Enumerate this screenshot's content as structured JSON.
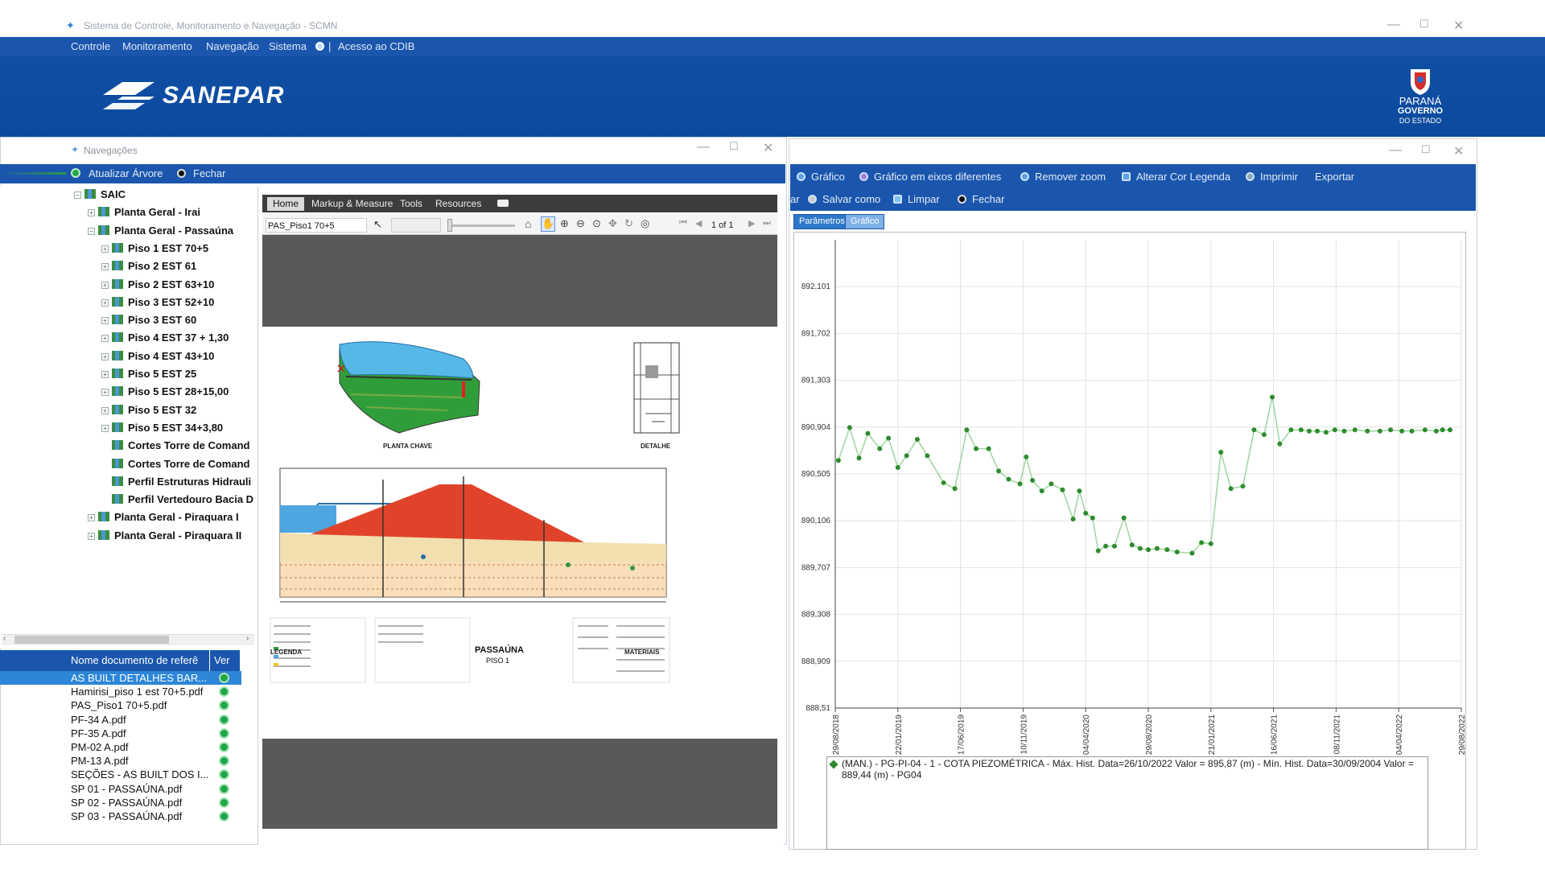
{
  "app": {
    "title": "Sistema de Controle, Monitoramento e Navegação - SCMN",
    "menu": [
      "Controle",
      "Monitoramento",
      "Navegação",
      "Sistema",
      "Acesso ao CDIB"
    ],
    "brand": "SANEPAR",
    "state_logo": [
      "PARANÁ",
      "GOVERNO",
      "DO ESTADO"
    ],
    "colors": {
      "primary": "#1a56ad",
      "banner": "#0f4fa4",
      "series": "#2e8b2e",
      "selected_row": "#2d86d7"
    }
  },
  "nav_window": {
    "title": "Navegações",
    "toolbar": {
      "refresh_label": "Atualizar Árvore",
      "close_label": "Fechar"
    },
    "tree": {
      "root": "SAIC",
      "items": [
        {
          "label": "Planta Geral - Irai",
          "level": 1,
          "expander": "+"
        },
        {
          "label": "Planta Geral - Passaúna",
          "level": 1,
          "expander": "−"
        },
        {
          "label": "Piso 1 EST 70+5",
          "level": 2,
          "expander": "+"
        },
        {
          "label": "Piso 2 EST 61",
          "level": 2,
          "expander": "+"
        },
        {
          "label": "Piso 2 EST 63+10",
          "level": 2,
          "expander": "+"
        },
        {
          "label": "Piso 3 EST 52+10",
          "level": 2,
          "expander": "+"
        },
        {
          "label": "Piso 3 EST 60",
          "level": 2,
          "expander": "+"
        },
        {
          "label": "Piso 4 EST 37 + 1,30",
          "level": 2,
          "expander": "+"
        },
        {
          "label": "Piso 4 EST 43+10",
          "level": 2,
          "expander": "+"
        },
        {
          "label": "Piso 5 EST 25",
          "level": 2,
          "expander": "+"
        },
        {
          "label": "Piso 5 EST 28+15,00",
          "level": 2,
          "expander": "+"
        },
        {
          "label": "Piso 5 EST 32",
          "level": 2,
          "expander": "+"
        },
        {
          "label": "Piso 5 EST 34+3,80",
          "level": 2,
          "expander": "+"
        },
        {
          "label": "Cortes Torre de Comand",
          "level": 2,
          "expander": ""
        },
        {
          "label": "Cortes Torre de Comand",
          "level": 2,
          "expander": ""
        },
        {
          "label": "Perfil Estruturas Hidrauli",
          "level": 2,
          "expander": ""
        },
        {
          "label": "Perfil Vertedouro Bacia D",
          "level": 2,
          "expander": ""
        },
        {
          "label": "Planta Geral - Piraquara I",
          "level": 1,
          "expander": "+"
        },
        {
          "label": "Planta Geral - Piraquara II",
          "level": 1,
          "expander": "+"
        }
      ]
    },
    "documents": {
      "header_name": "Nome documento de referê",
      "header_ver": "Ver",
      "rows": [
        "AS BUILT DETALHES BAR...",
        "Hamirisi_piso 1 est 70+5.pdf",
        "PAS_Piso1 70+5.pdf",
        "PF-34 A.pdf",
        "PF-35 A.pdf",
        "PM-02 A.pdf",
        "PM-13 A.pdf",
        "SEÇÕES - AS BUILT DOS I...",
        "SP 01 - PASSAÚNA.pdf",
        "SP 02 - PASSAÚNA.pdf",
        "SP 03 - PASSAÚNA.pdf"
      ],
      "selected_index": 0
    }
  },
  "pdf_viewer": {
    "tabs": [
      "Home",
      "Markup & Measure",
      "Tools",
      "Resources"
    ],
    "active_tab": "Home",
    "file": "PAS_Piso1 70+5",
    "page": "1 of 1",
    "drawing": {
      "labels": {
        "plan": "PLANTA CHAVE",
        "detail": "DETALHE",
        "title": "PASSAÚNA",
        "subtitle": "PISO 1",
        "legend": "LEGENDA",
        "materials": "MATERIAIS"
      }
    }
  },
  "chart_window": {
    "toolbar": {
      "row1": [
        "Gráfico",
        "Gráfico em eixos diferentes",
        "Remover zoom",
        "Alterar Cor Legenda",
        "Imprimir",
        "Exportar"
      ],
      "row2": [
        "ar",
        "Salvar como",
        "Limpar",
        "Fechar"
      ]
    },
    "tabs": [
      "Parâmetros",
      "Gráfico"
    ],
    "active_tab": "Gráfico",
    "legend": "(MAN.) - PG-PI-04 - 1 - COTA PIEZOMÉTRICA - Máx. Hist. Data=26/10/2022 Valor = 895,87 (m) - Mín. Hist. Data=30/09/2004 Valor = 889,44 (m) - PG04"
  },
  "chart_data": {
    "type": "line",
    "ylim": [
      888.51,
      892.5
    ],
    "yticks": [
      "892,101",
      "891,702",
      "891,303",
      "890,904",
      "890,505",
      "890,106",
      "889,707",
      "889,308",
      "888,909",
      "888,51"
    ],
    "ytick_values": [
      892.101,
      891.702,
      891.303,
      890.904,
      890.505,
      890.106,
      889.707,
      889.308,
      888.909,
      888.51
    ],
    "xticks": [
      "29/08/2018",
      "22/01/2019",
      "17/06/2019",
      "10/11/2019",
      "04/04/2020",
      "29/08/2020",
      "21/01/2021",
      "16/06/2021",
      "08/11/2021",
      "04/04/2022",
      "29/08/2022"
    ],
    "xlim": [
      0,
      10
    ],
    "series": [
      {
        "color": "#2e8b2e",
        "x": [
          0.05,
          0.23,
          0.38,
          0.52,
          0.71,
          0.85,
          1.0,
          1.14,
          1.31,
          1.47,
          1.73,
          1.91,
          2.1,
          2.25,
          2.45,
          2.61,
          2.77,
          2.95,
          3.05,
          3.15,
          3.3,
          3.45,
          3.63,
          3.8,
          3.9,
          4.0,
          4.11,
          4.2,
          4.32,
          4.46,
          4.61,
          4.74,
          4.87,
          5.0,
          5.14,
          5.3,
          5.46,
          5.7,
          5.85,
          6.0,
          6.16,
          6.32,
          6.51,
          6.69,
          6.85,
          6.98,
          7.1,
          7.28,
          7.44,
          7.57,
          7.7,
          7.84,
          7.98,
          8.13,
          8.3,
          8.5,
          8.7,
          8.87,
          9.05,
          9.21,
          9.42,
          9.6,
          9.7,
          9.82
        ],
        "values": [
          890.62,
          890.9,
          890.64,
          890.85,
          890.72,
          890.81,
          890.56,
          890.66,
          890.8,
          890.66,
          890.43,
          890.38,
          890.88,
          890.72,
          890.72,
          890.53,
          890.46,
          890.42,
          890.65,
          890.45,
          890.36,
          890.42,
          890.37,
          890.12,
          890.36,
          890.17,
          890.13,
          889.85,
          889.89,
          889.89,
          890.13,
          889.9,
          889.87,
          889.86,
          889.87,
          889.86,
          889.84,
          889.83,
          889.92,
          889.91,
          890.69,
          890.38,
          890.4,
          890.88,
          890.84,
          891.16,
          890.76,
          890.88,
          890.88,
          890.87,
          890.87,
          890.86,
          890.88,
          890.87,
          890.88,
          890.87,
          890.87,
          890.88,
          890.87,
          890.87,
          890.88,
          890.87,
          890.88,
          890.88
        ]
      }
    ],
    "grid": true,
    "legend_position": "bottom"
  }
}
